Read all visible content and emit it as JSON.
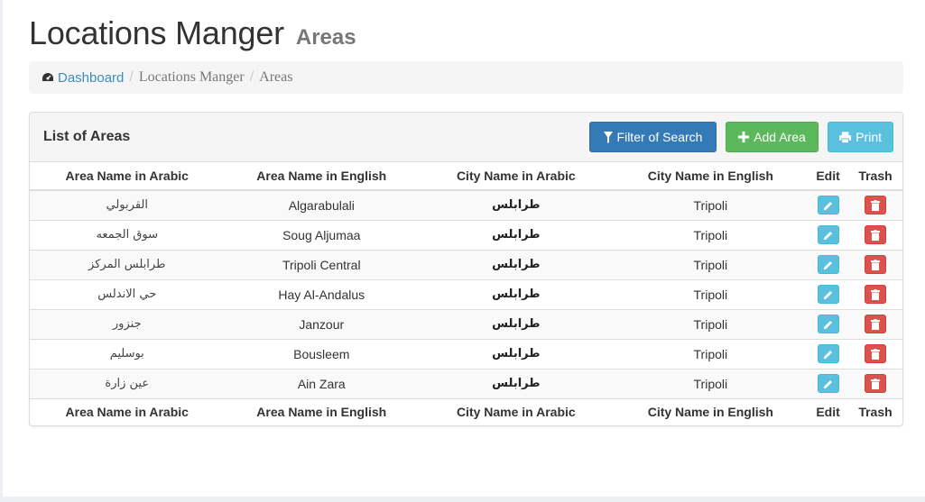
{
  "header": {
    "title": "Locations Manger",
    "subtitle": "Areas"
  },
  "breadcrumb": {
    "items": [
      "Dashboard",
      "Locations Manger",
      "Areas"
    ],
    "icon": "dashboard-icon"
  },
  "panel": {
    "title": "List of Areas",
    "buttons": {
      "filter": "Filter of Search",
      "add": "Add Area",
      "print": "Print"
    }
  },
  "table": {
    "headers": [
      "Area Name in Arabic",
      "Area Name in English",
      "City Name in Arabic",
      "City Name in English",
      "Edit",
      "Trash"
    ],
    "rows": [
      {
        "area_ar": "القربولي",
        "area_en": "Algarabulali",
        "city_ar": "طرابلس",
        "city_en": "Tripoli"
      },
      {
        "area_ar": "سوق الجمعه",
        "area_en": "Soug Aljumaa",
        "city_ar": "طرابلس",
        "city_en": "Tripoli"
      },
      {
        "area_ar": "طرابلس المركز",
        "area_en": "Tripoli Central",
        "city_ar": "طرابلس",
        "city_en": "Tripoli"
      },
      {
        "area_ar": "حي الاندلس",
        "area_en": "Hay Al-Andalus",
        "city_ar": "طرابلس",
        "city_en": "Tripoli"
      },
      {
        "area_ar": "جنزور",
        "area_en": "Janzour",
        "city_ar": "طرابلس",
        "city_en": "Tripoli"
      },
      {
        "area_ar": "بوسليم",
        "area_en": "Bousleem",
        "city_ar": "طرابلس",
        "city_en": "Tripoli"
      },
      {
        "area_ar": "عين زارة",
        "area_en": "Ain Zara",
        "city_ar": "طرابلس",
        "city_en": "Tripoli"
      }
    ]
  },
  "colors": {
    "primary": "#337ab7",
    "success": "#5cb85c",
    "info": "#5bc0de",
    "danger": "#d9534f",
    "link": "#3c8dbc"
  }
}
